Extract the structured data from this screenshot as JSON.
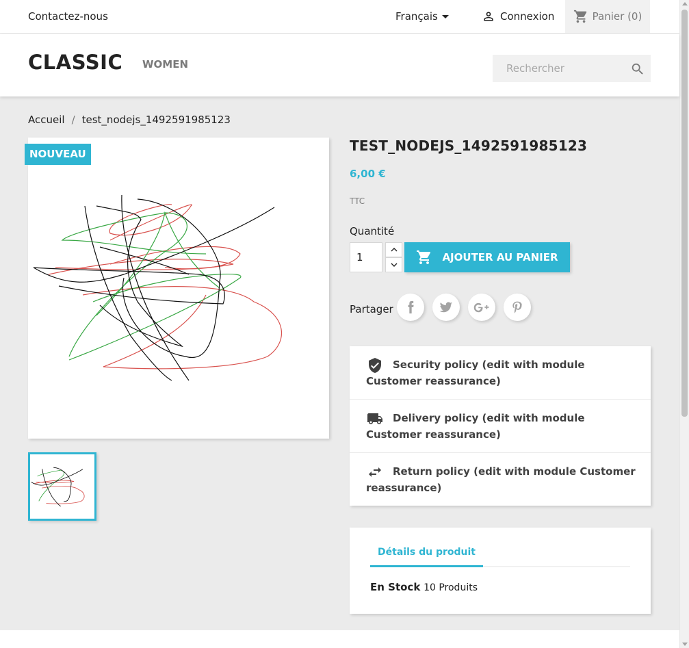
{
  "topnav": {
    "contact": "Contactez-nous",
    "language": "Français",
    "login": "Connexion",
    "cart": "Panier (0)"
  },
  "header": {
    "logo": "CLASSIC",
    "menu": [
      "WOMEN"
    ],
    "search_placeholder": "Rechercher"
  },
  "breadcrumb": {
    "home": "Accueil",
    "separator": "/",
    "current": "test_nodejs_1492591985123"
  },
  "product": {
    "badge": "NOUVEAU",
    "title": "TEST_NODEJS_1492591985123",
    "price": "6,00 €",
    "tax_label": "TTC",
    "quantity_label": "Quantité",
    "quantity_value": "1",
    "add_to_cart": "AJOUTER AU PANIER",
    "share_label": "Partager",
    "share_networks": [
      "facebook-icon",
      "twitter-icon",
      "google-plus-icon",
      "pinterest-icon"
    ]
  },
  "reassurance": [
    {
      "icon": "shield-check-icon",
      "text": "Security policy (edit with module Customer reassurance)"
    },
    {
      "icon": "truck-icon",
      "text": "Delivery policy (edit with module Customer reassurance)"
    },
    {
      "icon": "swap-arrows-icon",
      "text": "Return policy (edit with module Customer reassurance)"
    }
  ],
  "details": {
    "tab": "Détails du produit",
    "stock_label": "En Stock",
    "stock_qty": "10 Produits"
  },
  "colors": {
    "accent": "#2fb5d2",
    "background": "#ebebeb",
    "text": "#232323",
    "muted": "#7a7a7a",
    "scribble_red": "#d9534f",
    "scribble_green": "#3aa845",
    "scribble_black": "#111111"
  }
}
